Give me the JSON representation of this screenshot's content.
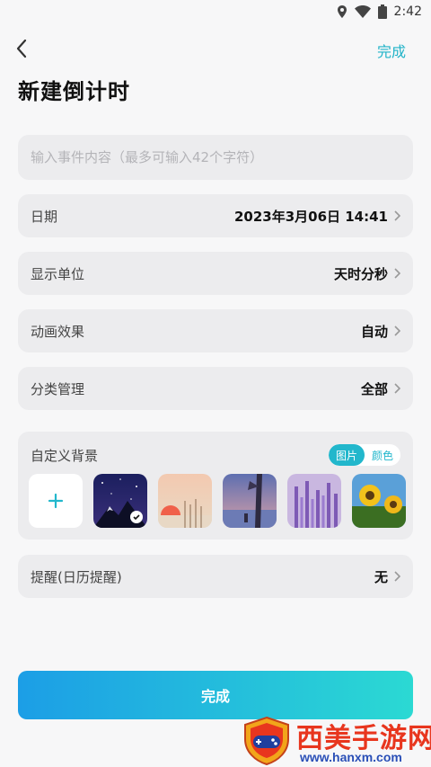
{
  "status_bar": {
    "time": "2:42",
    "icons": [
      "location-icon",
      "wifi-icon",
      "battery-icon"
    ]
  },
  "header": {
    "back_icon": "chevron-left-icon",
    "done_label": "完成"
  },
  "page": {
    "title": "新建倒计时"
  },
  "event_input": {
    "placeholder": "输入事件内容（最多可输入42个字符）",
    "value": ""
  },
  "rows": [
    {
      "label": "日期",
      "value": "2023年3月06日 14:41"
    },
    {
      "label": "显示单位",
      "value": "天时分秒"
    },
    {
      "label": "动画效果",
      "value": "自动"
    },
    {
      "label": "分类管理",
      "value": "全部"
    }
  ],
  "background": {
    "label": "自定义背景",
    "toggle_image": "图片",
    "toggle_color": "颜色",
    "add_icon": "plus-icon",
    "thumbnails": [
      {
        "name": "night-sky-mountain",
        "selected": true
      },
      {
        "name": "sunset-grass",
        "selected": false
      },
      {
        "name": "anime-tree-lake",
        "selected": false
      },
      {
        "name": "lavender-field",
        "selected": false
      },
      {
        "name": "sunflowers",
        "selected": false
      }
    ]
  },
  "reminder": {
    "label": "提醒(日历提醒)",
    "value": "无"
  },
  "footer": {
    "done_label": "完成"
  },
  "watermark": {
    "title": "西美手游网",
    "url": "www.hanxm.com"
  },
  "colors": {
    "accent": "#20b3c8",
    "gradient_start": "#1c9ee6",
    "gradient_end": "#2bd9d3",
    "card_bg": "#ececee"
  }
}
